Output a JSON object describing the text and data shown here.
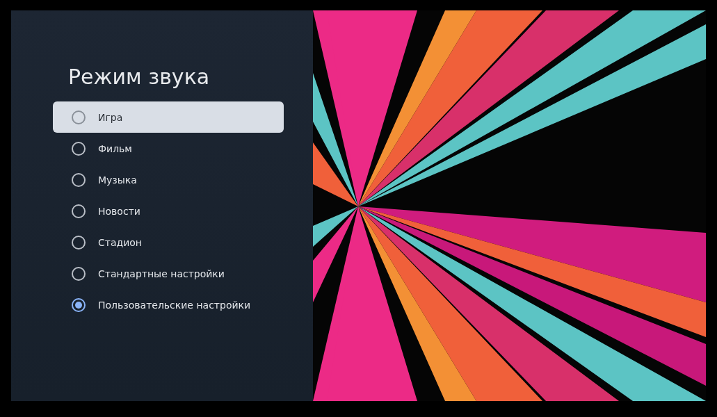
{
  "title": "Режим звука",
  "options": [
    {
      "label": "Игра",
      "focused": true,
      "selected": false
    },
    {
      "label": "Фильм",
      "focused": false,
      "selected": false
    },
    {
      "label": "Музыка",
      "focused": false,
      "selected": false
    },
    {
      "label": "Новости",
      "focused": false,
      "selected": false
    },
    {
      "label": "Стадион",
      "focused": false,
      "selected": false
    },
    {
      "label": "Стандартные настройки",
      "focused": false,
      "selected": false
    },
    {
      "label": "Пользовательские настройки",
      "focused": false,
      "selected": true
    }
  ]
}
